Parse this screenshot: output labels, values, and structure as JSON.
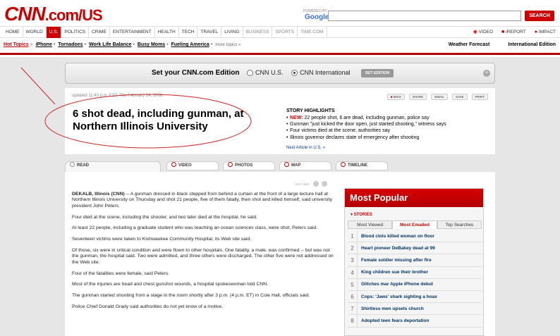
{
  "header": {
    "logo_cnn": "CNN",
    "logo_com": ".com",
    "logo_section": "/US",
    "powered_by": "POWERED BY",
    "google": "Google",
    "search_value": "",
    "search_button": "SEARCH"
  },
  "nav": {
    "items": [
      "HOME",
      "WORLD",
      "U.S.",
      "POLITICS",
      "CRIME",
      "ENTERTAINMENT",
      "HEALTH",
      "TECH",
      "TRAVEL",
      "LIVING",
      "BUSINESS",
      "SPORTS",
      "TIME.COM"
    ],
    "active": "U.S.",
    "right": [
      "VIDEO",
      "iREPORT",
      "IMPACT"
    ]
  },
  "hot_topics": {
    "label": "Hot Topics",
    "links": [
      "iPhone",
      "Tornadoes",
      "Work Life Balance",
      "Busy Moms",
      "Fueling America"
    ],
    "more": "more topics »",
    "right": [
      "Weather Forecast",
      "International Edition"
    ]
  },
  "edition": {
    "title": "Set your CNN.com Edition",
    "option_us": "CNN U.S.",
    "option_intl": "CNN International",
    "selected": "CNN International",
    "button": "SET EDITION"
  },
  "story": {
    "updated": "updated 11:43 p.m. EST, Thu February 14, 2008",
    "tools": [
      "MIXX",
      "SHARE",
      "EMAIL",
      "SAVE",
      "PRINT"
    ],
    "headline": "6 shot dead, including gunman, at Northern Illinois University",
    "highlights_title": "STORY HIGHLIGHTS",
    "highlights_new": "NEW:",
    "highlights": [
      "22 people shot, 6 are dead, including gunman, police say",
      "Gunman \"just kicked the door open, just started shooting,\" witness says",
      "Four victims died at the scene, authorities say",
      "Illinois governor declares state of emergency after shooting"
    ],
    "next_article": "Next Article in U.S. »"
  },
  "tabs": [
    "READ",
    "VIDEO",
    "PHOTOS",
    "MAP",
    "TIMELINE"
  ],
  "article": {
    "text_size_label": "TEXT SIZE",
    "dateline": "DEKALB, Illinois (CNN)",
    "paragraphs": [
      " -- A gunman dressed in black stepped from behind a curtain at the front of a large lecture hall at Northern Illinois University on Thursday and shot 21 people, five of them fatally, then shot and killed himself, said university president John Peters.",
      "Four died at the scene, including the shooter, and two later died at the hospital, he said.",
      "At least 22 people, including a graduate student who was teaching an ocean sciences class, were shot, Peters said.",
      "Seventeen victims were taken to Kishwaukee Community Hospital, its Web site said.",
      "Of those, six were in critical condition and were flown to other hospitals. One fatality, a male, was confirmed -- but was not the gunman, the hospital said. Two were admitted, and three others were discharged. The other five were not addressed on the Web site.",
      "Four of the fatalities were female, said Peters.",
      "Most of the injuries are head and chest gunshot wounds, a hospital spokeswoman told CNN.",
      "The gunman started shooting from a stage in the room shortly after 3 p.m. (4 p.m. ET) in Cole Hall, officials said.",
      "Police Chief Donald Grady said authorities do not yet know of a motive."
    ]
  },
  "popular": {
    "title": "Most Popular",
    "stories_label": "STORIES",
    "tabs": [
      "Most Viewed",
      "Most Emailed",
      "Top Searches"
    ],
    "active_tab": "Most Emailed",
    "items": [
      "Blood clots killed woman on floor",
      "Heart pioneer DeBakey dead at 99",
      "Female soldier missing after fire",
      "King children sue their brother",
      "Glitches mar Apple iPhone debut",
      "Cops: 'Jaws' shark sighting a hoax",
      "Shirtless men upsets church",
      "Adopted teen fears deportation"
    ]
  },
  "colors": {
    "brand_red": "#cc0000",
    "dark_red": "#b00000",
    "link_blue": "#003366",
    "background_gray": "#e6e6e6"
  }
}
